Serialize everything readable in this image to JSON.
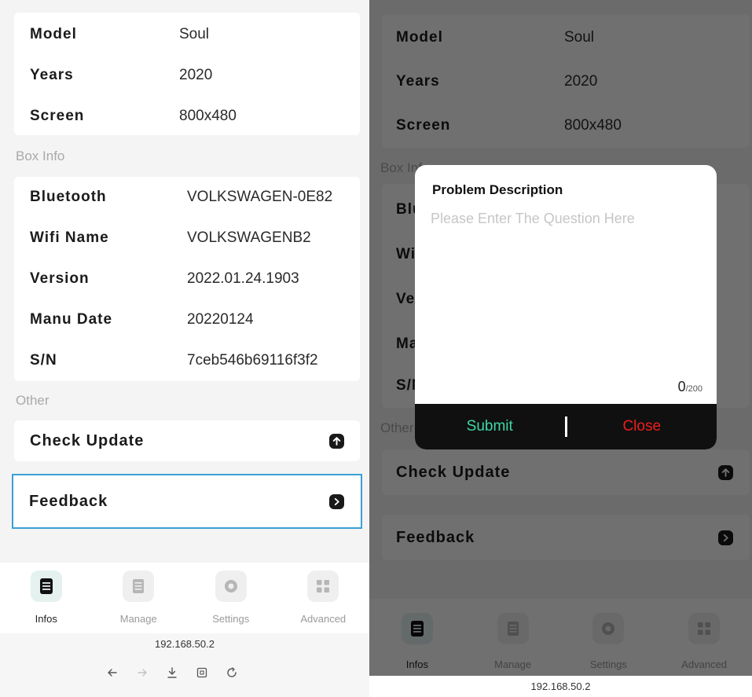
{
  "car_info": {
    "rows": [
      {
        "label": "Model",
        "value": "Soul"
      },
      {
        "label": "Years",
        "value": "2020"
      },
      {
        "label": "Screen",
        "value": "800x480"
      }
    ]
  },
  "box_info": {
    "title": "Box Info",
    "rows": [
      {
        "label": "Bluetooth",
        "value": "VOLKSWAGEN-0E82"
      },
      {
        "label": "Wifi Name",
        "value": "VOLKSWAGENB2"
      },
      {
        "label": "Version",
        "value": "2022.01.24.1903"
      },
      {
        "label": "Manu Date",
        "value": "20220124"
      },
      {
        "label": "S/N",
        "value": "7ceb546b69116f3f2"
      }
    ]
  },
  "other": {
    "title": "Other",
    "check_update": "Check Update",
    "feedback": "Feedback"
  },
  "tabs": [
    {
      "label": "Infos",
      "icon": "infos-icon"
    },
    {
      "label": "Manage",
      "icon": "manage-icon"
    },
    {
      "label": "Settings",
      "icon": "settings-icon"
    },
    {
      "label": "Advanced",
      "icon": "advanced-icon"
    }
  ],
  "browser": {
    "url": "192.168.50.2"
  },
  "dialog": {
    "title": "Problem Description",
    "placeholder": "Please Enter The Question Here",
    "count": "0",
    "max": "/200",
    "submit": "Submit",
    "close": "Close"
  },
  "colors": {
    "submit": "#3fd7a6",
    "close": "#f01c1c",
    "focus_border": "#3aa0d6"
  }
}
